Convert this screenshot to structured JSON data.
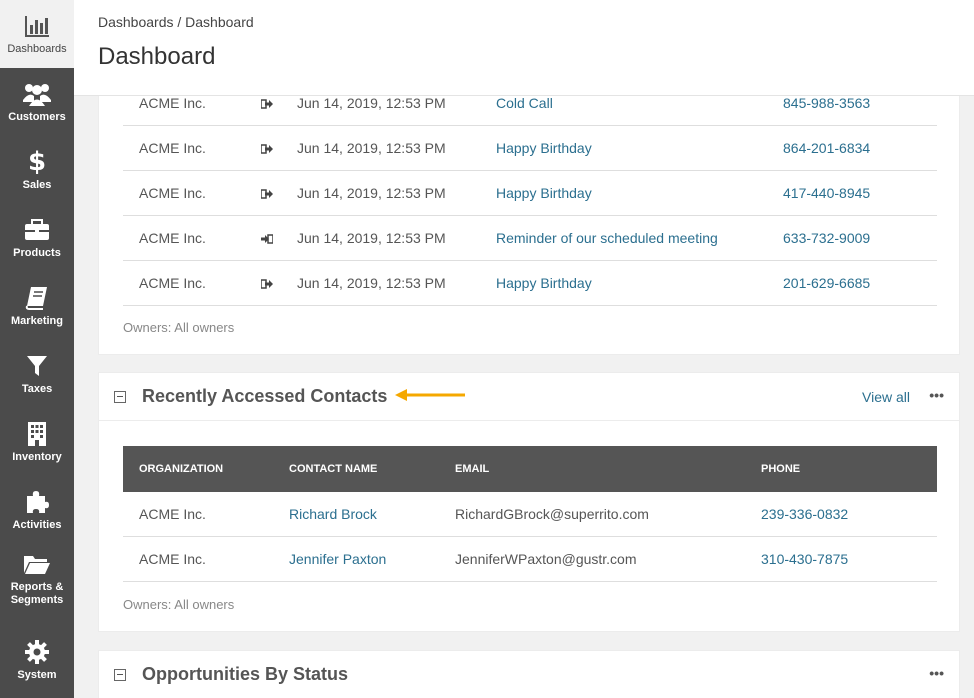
{
  "sidebar": {
    "items": [
      {
        "label": "Dashboards",
        "icon": "bar-chart-icon"
      },
      {
        "label": "Customers",
        "icon": "users-icon"
      },
      {
        "label": "Sales",
        "icon": "dollar-icon"
      },
      {
        "label": "Products",
        "icon": "briefcase-icon"
      },
      {
        "label": "Marketing",
        "icon": "book-icon"
      },
      {
        "label": "Taxes",
        "icon": "funnel-icon"
      },
      {
        "label": "Inventory",
        "icon": "building-icon"
      },
      {
        "label": "Activities",
        "icon": "puzzle-icon"
      },
      {
        "label": "Reports &\nSegments",
        "icon": "folder-icon"
      },
      {
        "label": "System",
        "icon": "gear-icon"
      }
    ]
  },
  "header": {
    "breadcrumb": "Dashboards / Dashboard",
    "title": "Dashboard"
  },
  "activities": {
    "rows": [
      {
        "org": "ACME Inc.",
        "direction": "out",
        "date": "Jun 14, 2019, 12:53 PM",
        "subject": "Cold Call",
        "phone": "845-988-3563"
      },
      {
        "org": "ACME Inc.",
        "direction": "out",
        "date": "Jun 14, 2019, 12:53 PM",
        "subject": "Happy Birthday",
        "phone": "864-201-6834"
      },
      {
        "org": "ACME Inc.",
        "direction": "out",
        "date": "Jun 14, 2019, 12:53 PM",
        "subject": "Happy Birthday",
        "phone": "417-440-8945"
      },
      {
        "org": "ACME Inc.",
        "direction": "in",
        "date": "Jun 14, 2019, 12:53 PM",
        "subject": "Reminder of our scheduled meeting",
        "phone": "633-732-9009"
      },
      {
        "org": "ACME Inc.",
        "direction": "out",
        "date": "Jun 14, 2019, 12:53 PM",
        "subject": "Happy Birthday",
        "phone": "201-629-6685"
      }
    ],
    "owners": "Owners: All owners"
  },
  "contacts": {
    "title": "Recently Accessed Contacts",
    "view_all": "View all",
    "more": "•••",
    "columns": [
      "ORGANIZATION",
      "CONTACT NAME",
      "EMAIL",
      "PHONE"
    ],
    "rows": [
      {
        "org": "ACME Inc.",
        "name": "Richard Brock",
        "email": "RichardGBrock@superrito.com",
        "phone": "239-336-0832"
      },
      {
        "org": "ACME Inc.",
        "name": "Jennifer Paxton",
        "email": "JenniferWPaxton@gustr.com",
        "phone": "310-430-7875"
      }
    ],
    "owners": "Owners: All owners"
  },
  "opportunities": {
    "title": "Opportunities By Status",
    "more": "•••"
  },
  "colors": {
    "sidebar": "#4b4b4b",
    "link": "#2b6f8f",
    "table_header": "#555555",
    "annotation_arrow": "#f5a800"
  }
}
